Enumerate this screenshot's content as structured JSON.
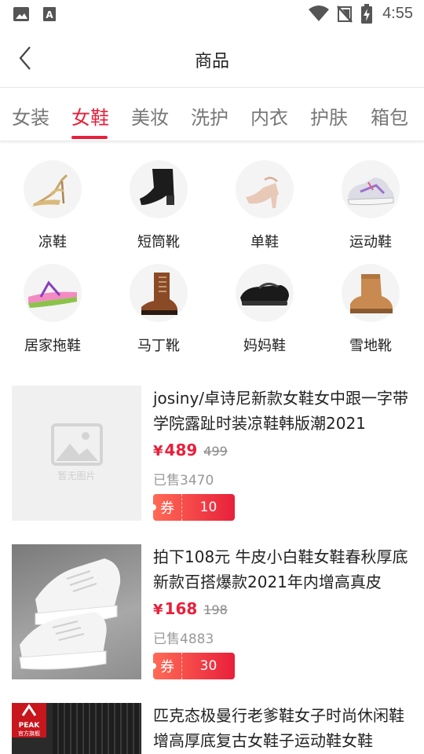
{
  "status_bar": {
    "time": "4:55"
  },
  "header": {
    "title": "商品"
  },
  "tabs": [
    {
      "label": "女装"
    },
    {
      "label": "女鞋"
    },
    {
      "label": "美妆"
    },
    {
      "label": "洗护"
    },
    {
      "label": "内衣"
    },
    {
      "label": "护肤"
    },
    {
      "label": "箱包"
    }
  ],
  "categories": [
    {
      "label": "凉鞋",
      "icon": "sandal-icon"
    },
    {
      "label": "短筒靴",
      "icon": "ankle-boot-icon"
    },
    {
      "label": "单鞋",
      "icon": "pump-icon"
    },
    {
      "label": "运动鞋",
      "icon": "sneaker-icon"
    },
    {
      "label": "居家拖鞋",
      "icon": "flip-flop-icon"
    },
    {
      "label": "马丁靴",
      "icon": "martin-boot-icon"
    },
    {
      "label": "妈妈鞋",
      "icon": "flat-shoe-icon"
    },
    {
      "label": "雪地靴",
      "icon": "snow-boot-icon"
    }
  ],
  "products": [
    {
      "title": "josiny/卓诗尼新款女鞋女中跟一字带学院露趾时装凉鞋韩版潮2021",
      "price_symbol": "¥",
      "price": "489",
      "original_price": "499",
      "sold": "已售3470",
      "coupon_label": "券",
      "coupon_value": "10",
      "placeholder_text": "暂无图片"
    },
    {
      "title": "拍下108元 牛皮小白鞋女鞋春秋厚底新款百搭爆款2021年内增高真皮",
      "price_symbol": "¥",
      "price": "168",
      "original_price": "198",
      "sold": "已售4883",
      "coupon_label": "券",
      "coupon_value": "30"
    },
    {
      "title": "匹克态极曼行老爹鞋女子时尚休闲鞋增高厚底复古女鞋子运动鞋女鞋",
      "brand_text": "PEAK",
      "store_text": "官方旗舰"
    }
  ],
  "colors": {
    "accent": "#e8203b",
    "muted": "#999999"
  }
}
